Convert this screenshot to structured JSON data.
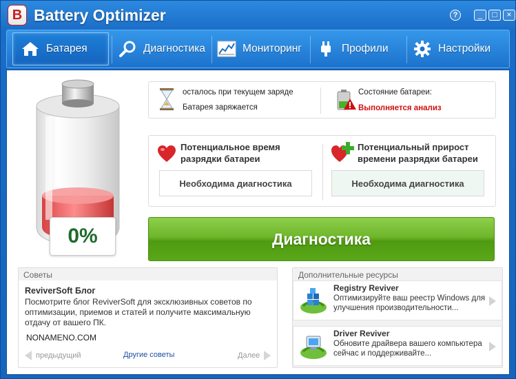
{
  "window": {
    "title": "Battery Optimizer",
    "logo_letter": "B",
    "help": "?",
    "minimize": "_",
    "maximize": "□",
    "close": "×"
  },
  "nav": {
    "items": [
      {
        "label": "Батарея",
        "icon": "home-icon",
        "active": true
      },
      {
        "label": "Диагностика",
        "icon": "magnifier-icon",
        "active": false
      },
      {
        "label": "Мониторинг",
        "icon": "chart-icon",
        "active": false
      },
      {
        "label": "Профили",
        "icon": "plug-icon",
        "active": false
      },
      {
        "label": "Настройки",
        "icon": "gear-icon",
        "active": false
      }
    ]
  },
  "battery": {
    "percent": "0%",
    "level": 0.0
  },
  "status": {
    "time_remaining_label": "осталось при текущем заряде",
    "charging_label": "Батарея заряжается",
    "state_label": "Состояние батареи:",
    "state_value": "Выполняется анализ"
  },
  "potential": {
    "time_title": "Потенциальное время разрядки батареи",
    "time_value": "Необходима диагностика",
    "gain_title": "Потенциальный прирост времени разрядки батареи",
    "gain_value": "Необходима диагностика"
  },
  "diagnose_button": "Диагностика",
  "tips": {
    "section_title": "Советы",
    "title": "ReviverSoft Блог",
    "body": "Посмотрите блог ReviverSoft для эксклюзивных советов по оптимизации, приемов и статей и получите максимальную отдачу от вашего ПК.",
    "author": "NONAMENO.COM",
    "prev": "предыдущий",
    "more": "Другие советы",
    "next": "Далее"
  },
  "resources": {
    "section_title": "Дополнительные ресурсы",
    "items": [
      {
        "title": "Registry Reviver",
        "desc": "Оптимизируйте ваш реестр Windows для улучшения производительности..."
      },
      {
        "title": "Driver Reviver",
        "desc": "Обновите драйвера вашего компьютера сейчас и поддерживайте..."
      }
    ]
  },
  "colors": {
    "accent_blue": "#1b6cc6",
    "green_button": "#6eb62b",
    "alert_red": "#d01010",
    "value_green": "#1f6b2d"
  }
}
